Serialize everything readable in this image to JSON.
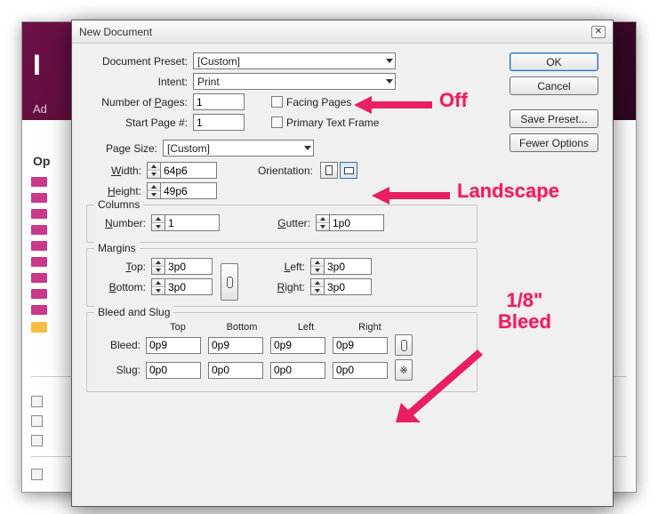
{
  "dialog": {
    "title": "New Document",
    "preset_label": "Document Preset:",
    "preset_value": "[Custom]",
    "intent_label": "Intent:",
    "intent_value": "Print",
    "num_pages_label_pre": "Number of ",
    "num_pages_underline": "P",
    "num_pages_label_post": "ages:",
    "num_pages_value": "1",
    "start_page_label": "Start Page #:",
    "start_page_value": "1",
    "facing_pages_label": "Facing Pages",
    "primary_text_frame_label": "Primary Text Frame"
  },
  "page_size": {
    "label": "Page Size:",
    "value": "[Custom]",
    "width_label_u": "W",
    "width_label_rest": "idth:",
    "width_value": "64p6",
    "height_label_u": "H",
    "height_label_rest": "eight:",
    "height_value": "49p6",
    "orientation_label": "Orientation:"
  },
  "columns": {
    "title": "Columns",
    "number_label_u": "N",
    "number_label_rest": "umber:",
    "number_value": "1",
    "gutter_label_u": "G",
    "gutter_label_rest": "utter:",
    "gutter_value": "1p0"
  },
  "margins": {
    "title": "Margins",
    "top_label_u": "T",
    "top_label_rest": "op:",
    "top_value": "3p0",
    "bottom_label_u": "B",
    "bottom_label_rest": "ottom:",
    "bottom_value": "3p0",
    "left_label_u": "L",
    "left_label_rest": "eft:",
    "left_value": "3p0",
    "right_label_u": "R",
    "right_label_rest": "ight:",
    "right_value": "3p0"
  },
  "bleed_slug": {
    "title": "Bleed and Slug",
    "col_top": "Top",
    "col_bottom": "Bottom",
    "col_left": "Left",
    "col_right": "Right",
    "bleed_label": "Bleed:",
    "bleed_top": "0p9",
    "bleed_bottom": "0p9",
    "bleed_left": "0p9",
    "bleed_right": "0p9",
    "slug_label": "Slug:",
    "slug_top": "0p0",
    "slug_bottom": "0p0",
    "slug_left": "0p0",
    "slug_right": "0p0"
  },
  "buttons": {
    "ok": "OK",
    "cancel": "Cancel",
    "save_preset": "Save Preset...",
    "fewer_options": "Fewer Options"
  },
  "annotations": {
    "off": "Off",
    "landscape": "Landscape",
    "bleed_line1": "1/8\"",
    "bleed_line2": "Bleed"
  },
  "background": {
    "logo_fragment": "I",
    "subtitle_fragment": "Ad",
    "open_header": "Op"
  }
}
